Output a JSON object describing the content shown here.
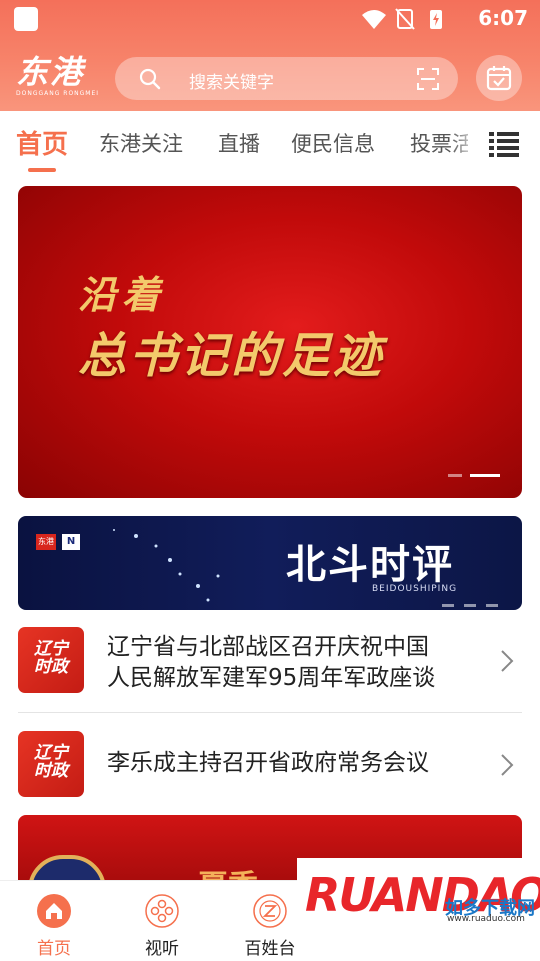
{
  "status_bar": {
    "time": "6:07"
  },
  "header": {
    "logo_text": "东港",
    "logo_subtitle": "DONGGANG RONGMEI",
    "search_placeholder": "搜索关键字"
  },
  "tabs": [
    {
      "label": "首页",
      "active": true
    },
    {
      "label": "东港关注",
      "active": false
    },
    {
      "label": "直播",
      "active": false
    },
    {
      "label": "便民信息",
      "active": false
    },
    {
      "label": "投票活",
      "active": false
    }
  ],
  "banner": {
    "line1": "沿着",
    "line2": "总书记的足迹",
    "slide_count": 2,
    "active_slide": 2
  },
  "beidou_banner": {
    "title": "北斗时评",
    "subtitle": "BEIDOUSHIPING",
    "logo1_text": "东港",
    "logo2_text": "N"
  },
  "news": [
    {
      "thumb_text": "辽宁时政",
      "title_line1": "辽宁省与北部战区召开庆祝中国",
      "title_line2": "人民解放军建军95周年军政座谈"
    },
    {
      "thumb_text": "辽宁时政",
      "title_line1": "李乐成主持召开省政府常务会议",
      "title_line2": ""
    }
  ],
  "bottom_card": {
    "text": "夏季"
  },
  "bottom_nav": [
    {
      "label": "首页",
      "icon": "home-icon",
      "active": true
    },
    {
      "label": "视听",
      "icon": "film-reel-icon",
      "active": false
    },
    {
      "label": "百姓台",
      "icon": "z-circle-icon",
      "active": false
    }
  ],
  "watermark": {
    "text": "RUANDAO",
    "text_cn": "如多下载网",
    "url": "www.ruaduo.com"
  },
  "colors": {
    "accent": "#f5704d",
    "header": "#f7836a",
    "banner_red": "#c10a0a",
    "navy": "#111d5a"
  }
}
